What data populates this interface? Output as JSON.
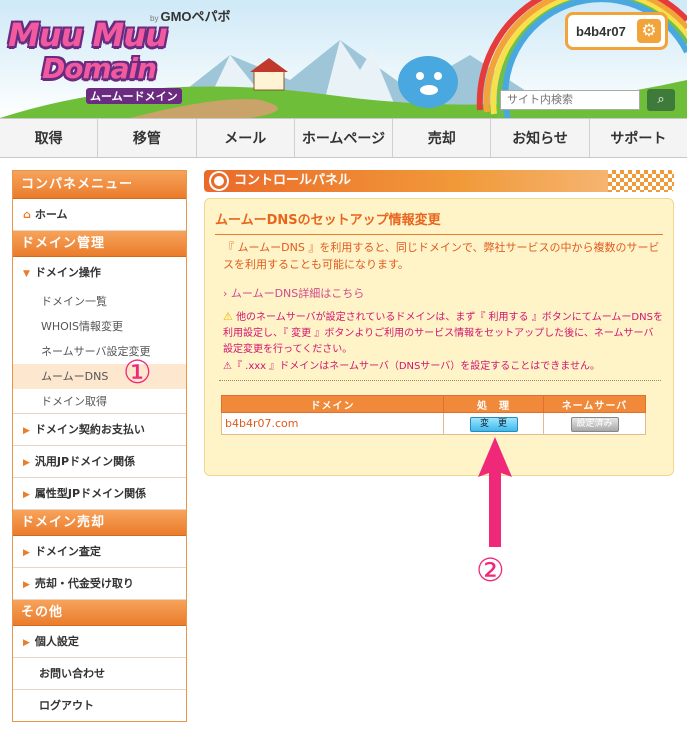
{
  "brand": {
    "by": "by",
    "gmo": "GMOペパボ",
    "logo_line1": "Muu Muu",
    "logo_line2": "Domain",
    "logo_sub": "ムームードメイン"
  },
  "user": {
    "name": "b4b4r07"
  },
  "search": {
    "placeholder": "サイト内検索"
  },
  "nav": [
    "取得",
    "移管",
    "メール",
    "ホームページ",
    "売却",
    "お知らせ",
    "サポート"
  ],
  "sidebar": {
    "menu_title": "コンパネメニュー",
    "home": "ホーム",
    "sec_manage": "ドメイン管理",
    "domain_ops": "ドメイン操作",
    "subs": [
      "ドメイン一覧",
      "WHOIS情報変更",
      "ネームサーバ設定変更",
      "ムームーDNS",
      "ドメイン取得"
    ],
    "contract": "ドメイン契約お支払い",
    "general_jp": "汎用JPドメイン関係",
    "attr_jp": "属性型JPドメイン関係",
    "sec_sell": "ドメイン売却",
    "appraisal": "ドメイン査定",
    "sell_receive": "売却・代金受け取り",
    "sec_other": "その他",
    "personal": "個人設定",
    "contact": "お問い合わせ",
    "logout": "ログアウト"
  },
  "panel": {
    "title": "コントロールパネル",
    "box_title": "ムームーDNSのセットアップ情報変更",
    "intro": "『 ムームーDNS 』を利用すると、同じドメインで、弊社サービスの中から複数のサービスを利用することも可能になります。",
    "link": "ムームーDNS詳細はこちら",
    "warning1": "他のネームサーバが設定されているドメインは、まず『 利用する 』ボタンにてムームーDNSを利用設定し、『 変更 』ボタンよりご利用のサービス情報をセットアップした後に、ネームサーバ設定変更を行ってください。",
    "warning2": "『 .xxx 』ドメインはネームサーバ（DNSサーバ）を設定することはできません。"
  },
  "table": {
    "headers": [
      "ドメイン",
      "処　理",
      "ネームサーバ"
    ],
    "rows": [
      {
        "domain": "b4b4r07.com",
        "action": "変　更",
        "ns": "設定済み"
      }
    ]
  },
  "annotations": {
    "one": "①",
    "two": "②"
  },
  "colors": {
    "accent": "#ea7c2c",
    "annotation": "#f0287a",
    "panel_bg": "#fff4c8"
  }
}
